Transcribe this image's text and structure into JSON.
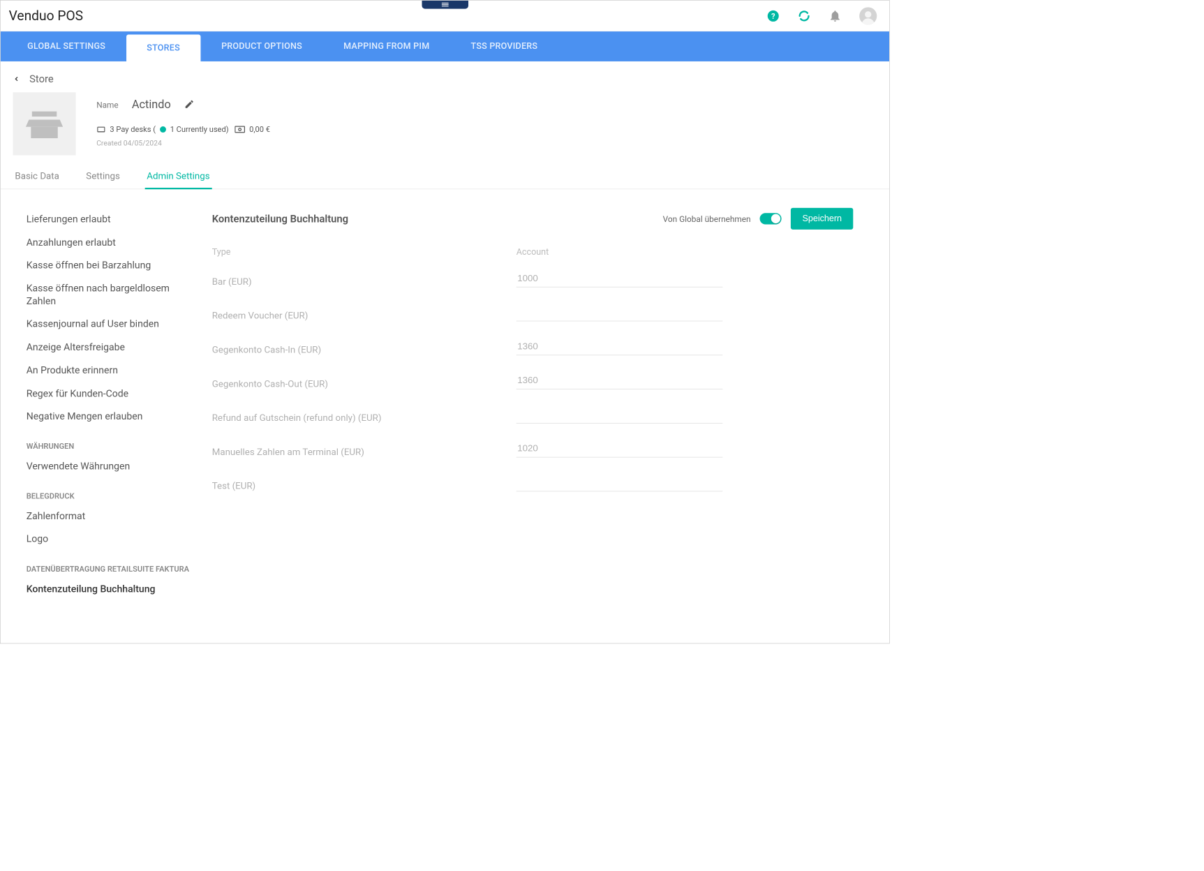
{
  "app": {
    "title": "Venduo POS"
  },
  "nav": {
    "tabs": [
      {
        "label": "GLOBAL SETTINGS"
      },
      {
        "label": "STORES"
      },
      {
        "label": "PRODUCT OPTIONS"
      },
      {
        "label": "MAPPING FROM PIM"
      },
      {
        "label": "TSS PROVIDERS"
      }
    ],
    "active": "STORES"
  },
  "breadcrumb": {
    "label": "Store"
  },
  "store": {
    "name_label": "Name",
    "name_value": "Actindo",
    "paydesks_text": "3 Pay desks (",
    "currently_used": "1 Currently used)",
    "amount": "0,00 €",
    "created": "Created 04/05/2024"
  },
  "subtabs": {
    "items": [
      {
        "label": "Basic Data"
      },
      {
        "label": "Settings"
      },
      {
        "label": "Admin Settings"
      }
    ],
    "active": "Admin Settings"
  },
  "sidebar": {
    "items": [
      {
        "label": "Lieferungen erlaubt",
        "type": "item"
      },
      {
        "label": "Anzahlungen erlaubt",
        "type": "item"
      },
      {
        "label": "Kasse öffnen bei Barzahlung",
        "type": "item"
      },
      {
        "label": "Kasse öffnen nach bargeldlosem Zahlen",
        "type": "item"
      },
      {
        "label": "Kassenjournal auf User binden",
        "type": "item"
      },
      {
        "label": "Anzeige Altersfreigabe",
        "type": "item"
      },
      {
        "label": "An Produkte erinnern",
        "type": "item"
      },
      {
        "label": "Regex für Kunden-Code",
        "type": "item"
      },
      {
        "label": "Negative Mengen erlauben",
        "type": "item"
      },
      {
        "label": "WÄHRUNGEN",
        "type": "heading"
      },
      {
        "label": "Verwendete Währungen",
        "type": "item"
      },
      {
        "label": "BELEGDRUCK",
        "type": "heading"
      },
      {
        "label": "Zahlenformat",
        "type": "item"
      },
      {
        "label": "Logo",
        "type": "item"
      },
      {
        "label": "DATENÜBERTRAGUNG RETAILSUITE FAKTURA",
        "type": "heading"
      },
      {
        "label": "Kontenzuteilung Buchhaltung",
        "type": "item",
        "selected": true
      }
    ]
  },
  "form": {
    "title": "Kontenzuteilung Buchhaltung",
    "inherit_label": "Von Global übernehmen",
    "save_label": "Speichern",
    "col_type": "Type",
    "col_account": "Account",
    "rows": [
      {
        "type": "Bar (EUR)",
        "account": "1000"
      },
      {
        "type": "Redeem Voucher (EUR)",
        "account": ""
      },
      {
        "type": "Gegenkonto Cash-In (EUR)",
        "account": "1360"
      },
      {
        "type": "Gegenkonto Cash-Out (EUR)",
        "account": "1360"
      },
      {
        "type": "Refund auf Gutschein (refund only) (EUR)",
        "account": ""
      },
      {
        "type": "Manuelles Zahlen am Terminal (EUR)",
        "account": "1020"
      },
      {
        "type": "Test (EUR)",
        "account": ""
      }
    ]
  }
}
